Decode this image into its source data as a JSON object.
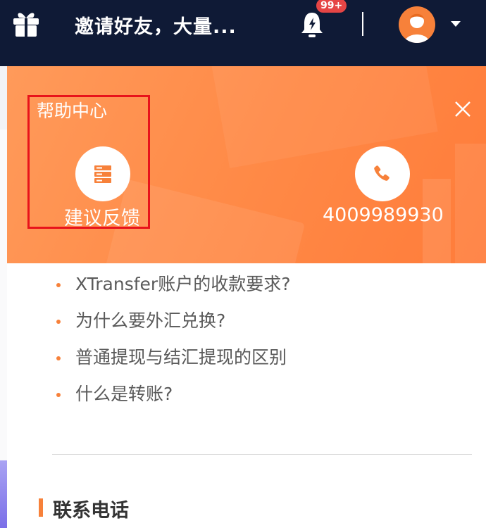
{
  "topbar": {
    "title": "邀请好友，大量...",
    "notification_badge": "99+",
    "icons": {
      "gift": "gift-icon",
      "bell": "bell-icon",
      "avatar": "avatar",
      "dropdown": "chevron-down-icon"
    }
  },
  "help_center": {
    "title": "帮助中心",
    "feedback_label": "建议反馈",
    "phone_number": "4009989930",
    "icons": {
      "feedback": "server-icon",
      "phone": "phone-icon",
      "close": "close-icon"
    }
  },
  "faq": {
    "items": [
      {
        "label": "XTransfer账户的收款要求?"
      },
      {
        "label": "为什么要外汇兑换?"
      },
      {
        "label": "普通提现与结汇提现的区别"
      },
      {
        "label": "什么是转账?"
      }
    ]
  },
  "contact": {
    "title": "联系电话"
  },
  "colors": {
    "topbar_bg": "#0f1a36",
    "accent": "#f7813a",
    "banner": "#ff8a47",
    "highlight_border": "#e8131b",
    "badge": "#e64545"
  }
}
